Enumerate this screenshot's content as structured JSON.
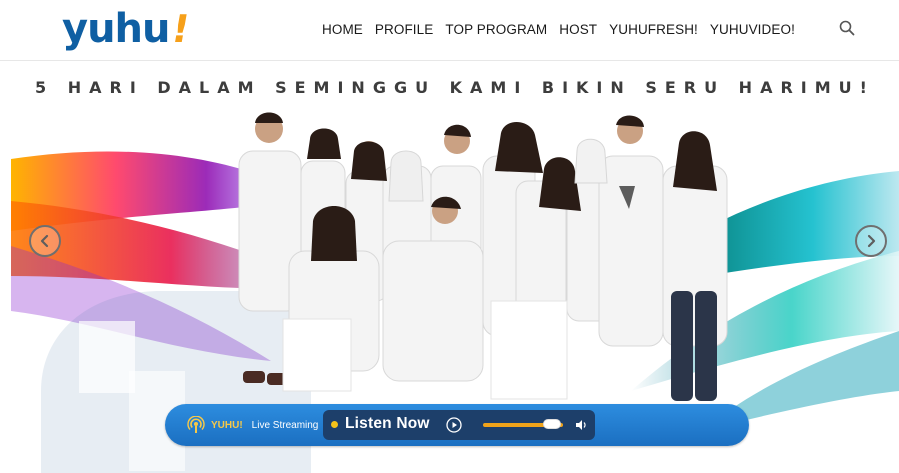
{
  "brand": {
    "logo_text": "yuhu",
    "logo_mark": "!"
  },
  "nav": {
    "items": [
      "HOME",
      "PROFILE",
      "TOP PROGRAM",
      "HOST",
      "YUHUFRESH!",
      "YUHUVIDEO!"
    ]
  },
  "icons": {
    "search": "search-icon",
    "prev": "chevron-left-icon",
    "next": "chevron-right-icon",
    "podcast": "podcast-icon",
    "play": "play-icon",
    "speaker": "speaker-icon"
  },
  "hero": {
    "tagline": "5 HARI DALAM SEMINGGU KAMI BIKIN SERU HARIMU!"
  },
  "player": {
    "brand": "YUHU!",
    "brand_suffix": "Live Streaming",
    "listen_label": "Listen  Now",
    "volume_level": 0.86
  },
  "colors": {
    "brand_blue": "#0f5fa3",
    "brand_orange": "#f6a01a",
    "player_blue": "#2d8ddf",
    "player_dark": "#1d3f6a",
    "accent_yellow": "#f4c21a"
  }
}
